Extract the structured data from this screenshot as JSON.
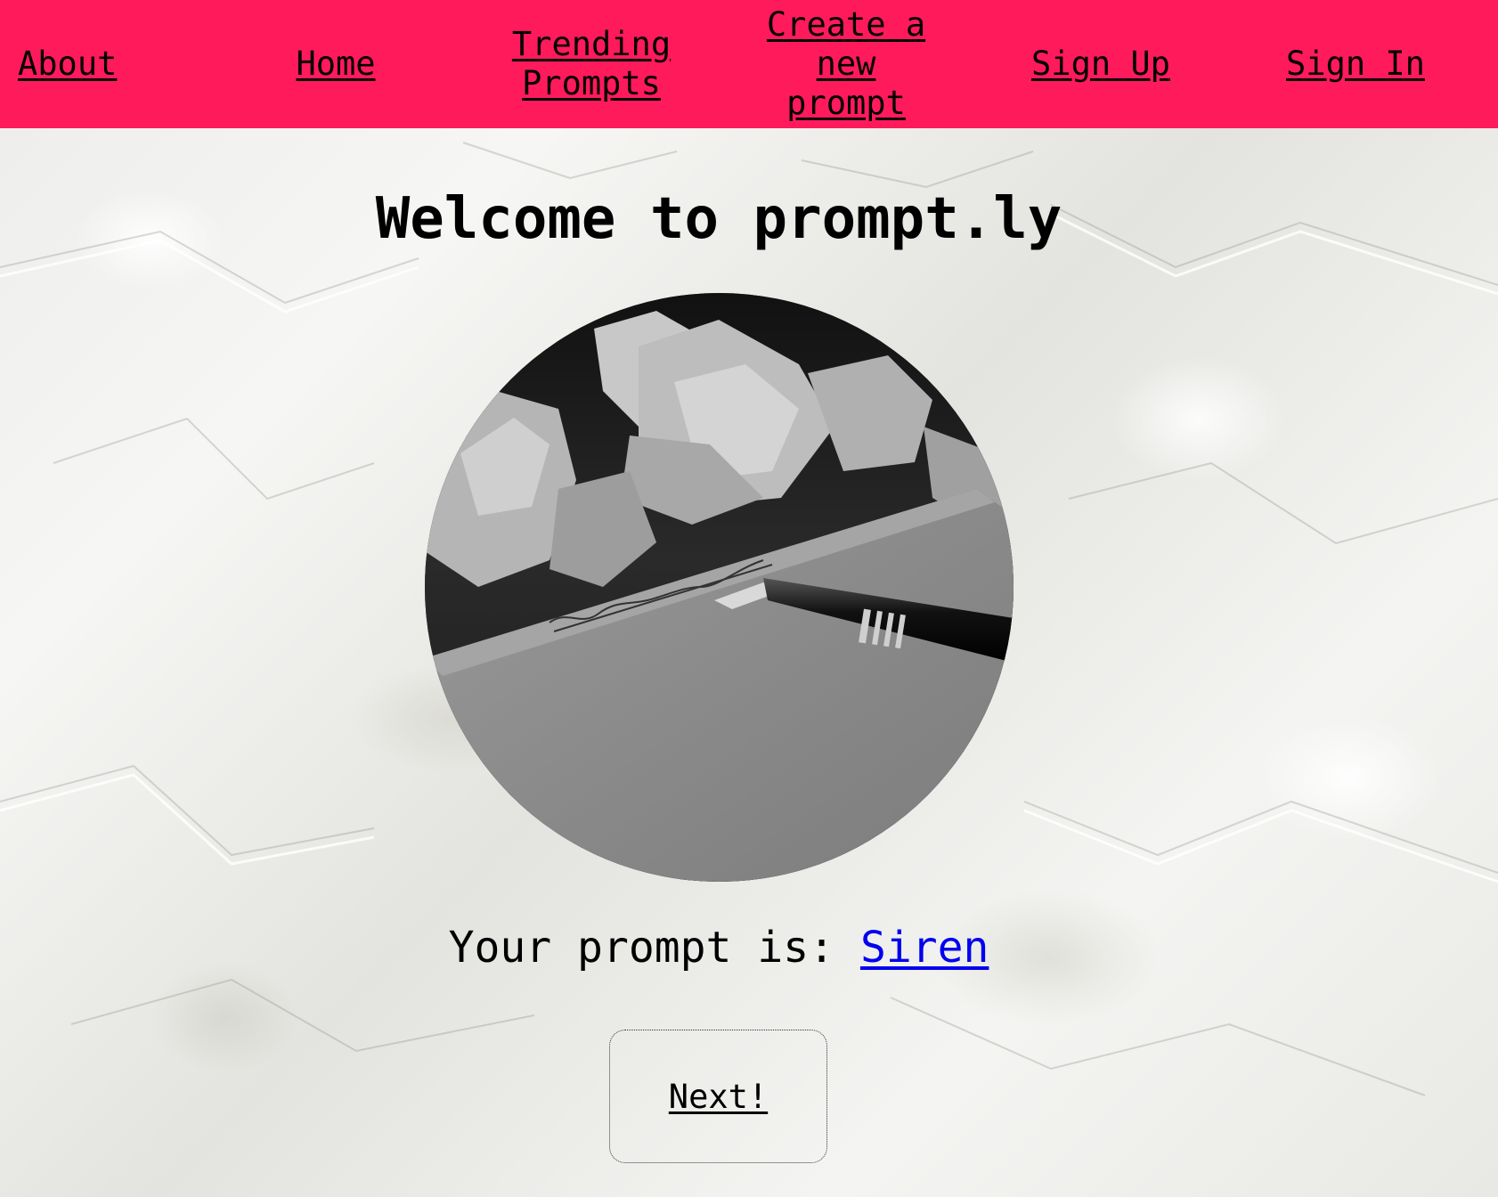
{
  "nav": {
    "items": [
      {
        "label": "About"
      },
      {
        "label": "Home"
      },
      {
        "label": "Trending\nPrompts"
      },
      {
        "label": "Create a\nnew prompt"
      },
      {
        "label": "Sign Up"
      },
      {
        "label": "Sign In"
      }
    ]
  },
  "main": {
    "title": "Welcome to prompt.ly",
    "prompt_prefix": "Your prompt is: ",
    "prompt_word": "Siren",
    "next_label": "Next!",
    "hero_image_icon": "writing-desk-image"
  },
  "colors": {
    "nav_background": "#ff1a5c",
    "link": "#0000ee",
    "text": "#000000"
  }
}
